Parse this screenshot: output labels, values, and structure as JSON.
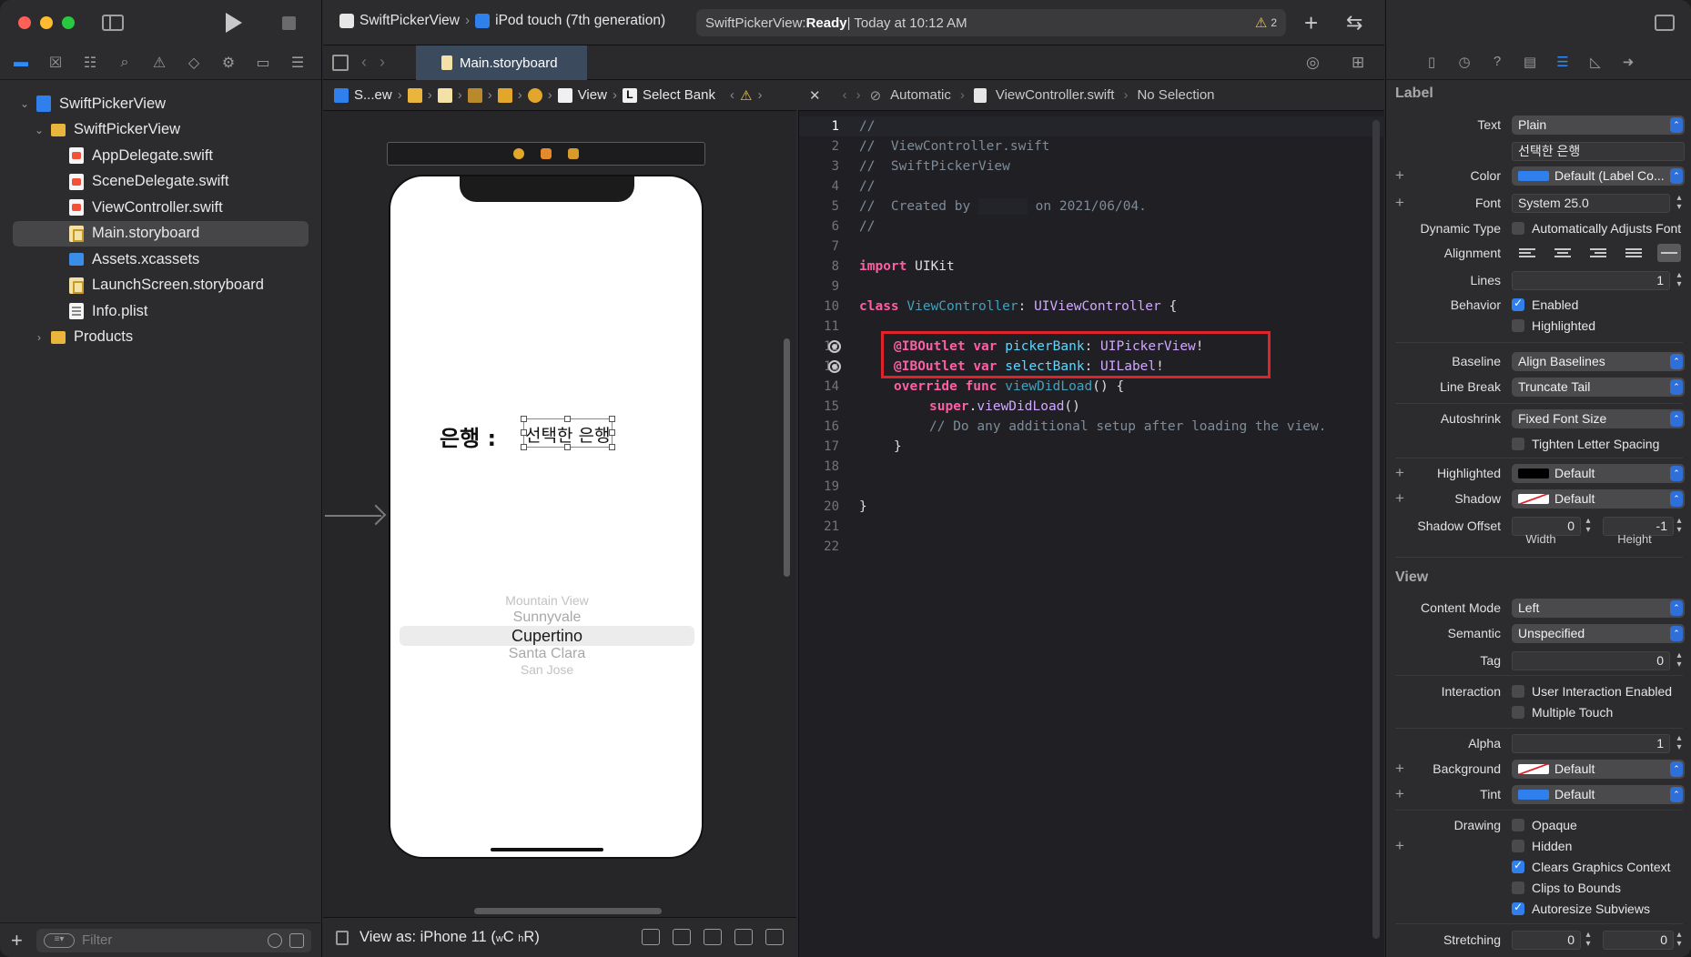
{
  "navigator": {
    "project": "SwiftPickerView",
    "group": "SwiftPickerView",
    "files": [
      {
        "name": "AppDelegate.swift",
        "kind": "swift"
      },
      {
        "name": "SceneDelegate.swift",
        "kind": "swift"
      },
      {
        "name": "ViewController.swift",
        "kind": "swift"
      },
      {
        "name": "Main.storyboard",
        "kind": "storyboard",
        "selected": true
      },
      {
        "name": "Assets.xcassets",
        "kind": "assets"
      },
      {
        "name": "LaunchScreen.storyboard",
        "kind": "storyboard"
      },
      {
        "name": "Info.plist",
        "kind": "plist"
      }
    ],
    "products": "Products",
    "filter_placeholder": "Filter"
  },
  "toolbar": {
    "scheme": "SwiftPickerView",
    "device": "iPod touch (7th generation)",
    "status_prefix": "SwiftPickerView: ",
    "status_state": "Ready",
    "status_time": " | Today at 10:12 AM",
    "warning_count": "2"
  },
  "tab": {
    "label": "Main.storyboard"
  },
  "jumpbar_left": {
    "first": "S...ew",
    "view": "View",
    "label": "Select Bank"
  },
  "jumpbar_right": {
    "mode": "Automatic",
    "file": "ViewController.swift",
    "selection": "No Selection"
  },
  "canvas": {
    "bank_label": "은행 :",
    "selected_bank": "선택한 은행",
    "picker_items": [
      "Mountain View",
      "Sunnyvale",
      "Cupertino",
      "Santa Clara",
      "San Jose"
    ],
    "view_as": "View as: iPhone 11 (",
    "view_as_w": "w",
    "view_as_c": "C ",
    "view_as_h": "h",
    "view_as_r": "R)"
  },
  "code": {
    "comment_slashes": "//",
    "file_comment": "//  ViewController.swift",
    "project_comment": "//  SwiftPickerView",
    "created_by": "//  Created by ",
    "created_on": " on 2021/06/04.",
    "import_kw": "import",
    "import_mod": " UIKit",
    "class_kw": "class",
    "class_name": "ViewController",
    "superclass": "UIViewController",
    "outlet_attr": "@IBOutlet",
    "var_kw": "var",
    "outlet1_name": "pickerBank",
    "outlet1_type": "UIPickerView",
    "outlet2_name": "selectBank",
    "outlet2_type": "UILabel",
    "override_kw": "override",
    "func_kw": "func",
    "fn_name": "viewDidLoad",
    "super_kw": "super",
    "super_call": "viewDidLoad",
    "setup_comment": "// Do any additional setup after loading the view.",
    "line_numbers": [
      "1",
      "2",
      "3",
      "4",
      "5",
      "6",
      "7",
      "8",
      "9",
      "10",
      "11",
      "12",
      "13",
      "14",
      "15",
      "16",
      "17",
      "18",
      "19",
      "20",
      "21",
      "22"
    ]
  },
  "inspector": {
    "label_section": "Label",
    "text_label": "Text",
    "text_value": "Plain",
    "text_content": "선택한 은행",
    "color_label": "Color",
    "color_value": "Default (Label Co...",
    "font_label": "Font",
    "font_value": "System 25.0",
    "dyn_label": "Dynamic Type",
    "dyn_value": "Automatically Adjusts Font",
    "align_label": "Alignment",
    "lines_label": "Lines",
    "lines_value": "1",
    "behavior_label": "Behavior",
    "enabled": "Enabled",
    "highlighted_chk": "Highlighted",
    "baseline_label": "Baseline",
    "baseline_value": "Align Baselines",
    "linebreak_label": "Line Break",
    "linebreak_value": "Truncate Tail",
    "autoshrink_label": "Autoshrink",
    "autoshrink_value": "Fixed Font Size",
    "tighten": "Tighten Letter Spacing",
    "highlighted_label": "Highlighted",
    "highlighted_value": "Default",
    "shadow_label": "Shadow",
    "shadow_value": "Default",
    "shadow_offset_label": "Shadow Offset",
    "shadow_w": "0",
    "shadow_h": "-1",
    "width_sub": "Width",
    "height_sub": "Height",
    "view_section": "View",
    "content_mode_label": "Content Mode",
    "content_mode_value": "Left",
    "semantic_label": "Semantic",
    "semantic_value": "Unspecified",
    "tag_label": "Tag",
    "tag_value": "0",
    "interaction_label": "Interaction",
    "user_interaction": "User Interaction Enabled",
    "multi_touch": "Multiple Touch",
    "alpha_label": "Alpha",
    "alpha_value": "1",
    "background_label": "Background",
    "background_value": "Default",
    "tint_label": "Tint",
    "tint_value": "Default",
    "drawing_label": "Drawing",
    "opaque": "Opaque",
    "hidden": "Hidden",
    "clears": "Clears Graphics Context",
    "clips": "Clips to Bounds",
    "autoresize": "Autoresize Subviews",
    "stretching_label": "Stretching",
    "stretch_a": "0",
    "stretch_b": "0"
  },
  "colors": {
    "accent": "#2f80ed",
    "highlight_box": "#e0232b",
    "keyword": "#fc5fa3",
    "type": "#5dd8ff"
  }
}
